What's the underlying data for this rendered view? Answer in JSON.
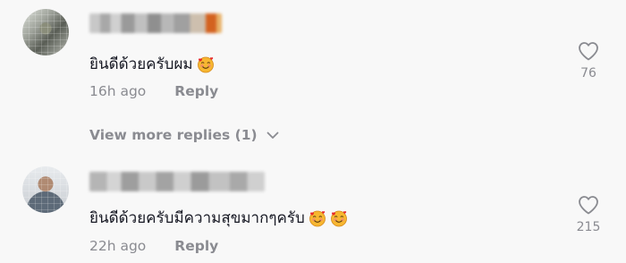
{
  "comments": [
    {
      "text": "ยินดีด้วยครับผม",
      "emojis": [
        "smiling-face-with-hearts"
      ],
      "time": "16h ago",
      "reply_label": "Reply",
      "likes": "76"
    },
    {
      "text": "ยินดีด้วยครับมีความสุขมากๆครับ",
      "emojis": [
        "smiling-face-with-hearts",
        "smiling-face-with-hearts"
      ],
      "time": "22h ago",
      "reply_label": "Reply",
      "likes": "215"
    }
  ],
  "view_more_label": "View more replies (1)",
  "colors": {
    "background": "#f8f8f8",
    "primary_text": "#161823",
    "secondary_text": "#8a8b91"
  }
}
